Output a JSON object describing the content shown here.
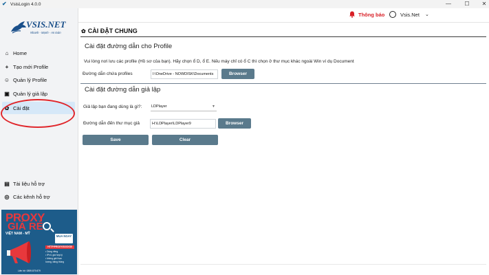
{
  "window": {
    "title": "VsisLogin 4.0.0",
    "minimize": "—",
    "maximize": "☐",
    "close": "✕"
  },
  "logo": {
    "name": "VSIS.NET",
    "tagline": "Nhanh - Mạnh - An toàn"
  },
  "sidebar": {
    "items": [
      {
        "label": "Home",
        "icon": "home-icon"
      },
      {
        "label": "Tạo mới Profile",
        "icon": "plus-icon"
      },
      {
        "label": "Quản lý Profile",
        "icon": "profile-icon"
      },
      {
        "label": "Quản lý giả lập",
        "icon": "emulator-icon"
      },
      {
        "label": "Cài đặt",
        "icon": "gear-icon"
      }
    ],
    "bottom_items": [
      {
        "label": "Tài liệu hỗ trợ",
        "icon": "document-icon"
      },
      {
        "label": "Các kênh hỗ trợ",
        "icon": "support-icon"
      }
    ],
    "active_index": 4
  },
  "banner": {
    "line1": "PROXY",
    "line2": "GIÁ RẺ",
    "line3": "VIỆT NAM - MỸ",
    "buy": "MUA NGAY",
    "http": "HTTP/PROXY/SOCKS5",
    "features": [
      "• Dùng riêng",
      "• IPv4, giá hợp lý",
      "• không giới hạn",
      "  lượng, băng thông"
    ],
    "contact": "Liên hệ: 0859.879.879"
  },
  "header": {
    "notification_label": "Thông báo",
    "user_label": "Vsis.Net",
    "user_chevron": "⌄"
  },
  "page": {
    "title": "CÀI ĐẶT CHUNG",
    "profile_section": {
      "heading": "Cài đặt đường dẫn cho Profile",
      "description": "Vui lòng nơi lưu các profile (Hồ sơ của bạn). Hãy chọn ổ D, ổ E. Nếu máy chỉ có ổ C thì chọn ở thư mục khác ngoài Win ví dụ Document",
      "path_label": "Đường dẫn chứa profiles",
      "path_value": "I:\\OneDrive - NOWDISK\\Documents",
      "browse_label": "Browser"
    },
    "emulator_section": {
      "heading": "Cài đặt đường dẫn giả lập",
      "emulator_label": "Giả lập bạn đang dùng là gì?:",
      "emulator_value": "LDPlayer",
      "folder_label": "Đường dẫn đến thư mục giả",
      "folder_value": "H:\\LDPlayer\\LDPlayer9",
      "browse_label": "Browser"
    },
    "save_label": "Save",
    "clear_label": "Clear"
  },
  "colors": {
    "accent_button": "#5a7a8c",
    "notification": "#d81f26",
    "active_nav": "#d6e8f8"
  }
}
